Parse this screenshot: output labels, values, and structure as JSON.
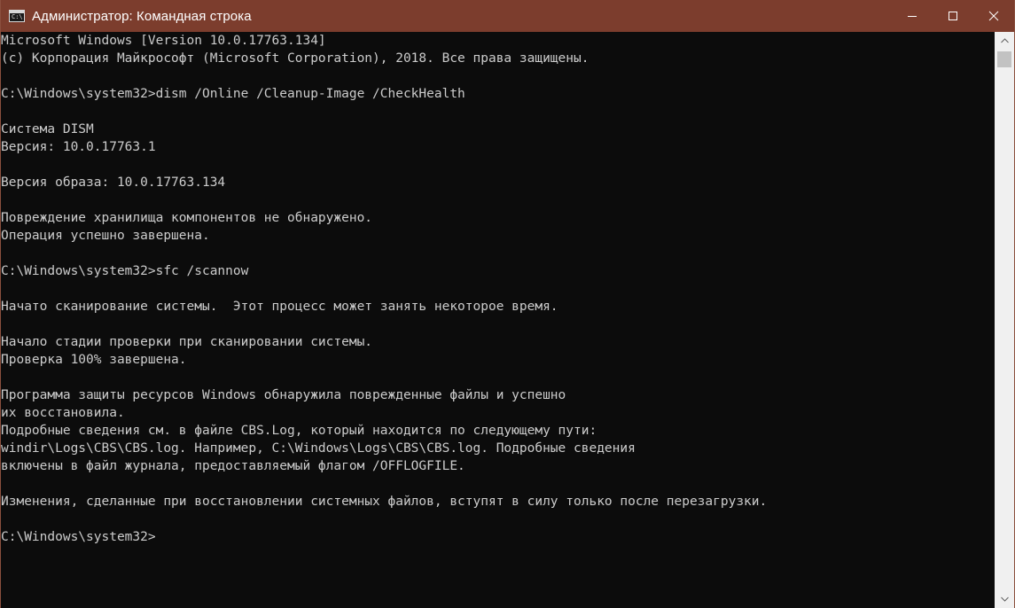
{
  "window": {
    "title": "Администратор: Командная строка",
    "icon_label": "C:\\",
    "controls": {
      "minimize": "minimize-icon",
      "maximize": "maximize-icon",
      "close": "close-icon"
    }
  },
  "console": {
    "lines": [
      "Microsoft Windows [Version 10.0.17763.134]",
      "(c) Корпорация Майкрософт (Microsoft Corporation), 2018. Все права защищены.",
      "",
      "C:\\Windows\\system32>dism /Online /Cleanup-Image /CheckHealth",
      "",
      "Система DISM",
      "Версия: 10.0.17763.1",
      "",
      "Версия образа: 10.0.17763.134",
      "",
      "Повреждение хранилища компонентов не обнаружено.",
      "Операция успешно завершена.",
      "",
      "C:\\Windows\\system32>sfc /scannow",
      "",
      "Начато сканирование системы.  Этот процесс может занять некоторое время.",
      "",
      "Начало стадии проверки при сканировании системы.",
      "Проверка 100% завершена.",
      "",
      "Программа защиты ресурсов Windows обнаружила поврежденные файлы и успешно",
      "их восстановила.",
      "Подробные сведения см. в файле CBS.Log, который находится по следующему пути:",
      "windir\\Logs\\CBS\\CBS.log. Например, C:\\Windows\\Logs\\CBS\\CBS.log. Подробные сведения",
      "включены в файл журнала, предоставляемый флагом /OFFLOGFILE.",
      "",
      "Изменения, сделанные при восстановлении системных файлов, вступят в силу только после перезагрузки.",
      "",
      "C:\\Windows\\system32>"
    ]
  },
  "colors": {
    "titlebar": "#7c3d2d",
    "console_bg": "#0c0c0c",
    "console_text": "#cccccc"
  }
}
